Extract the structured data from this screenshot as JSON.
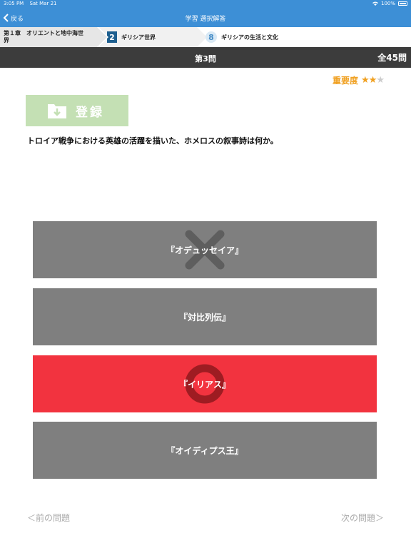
{
  "status_bar": {
    "time": "3:05 PM",
    "date": "Sat Mar 21",
    "battery": "100%"
  },
  "nav": {
    "back_label": "戻る",
    "title": "学習 選択解答"
  },
  "breadcrumb": {
    "chapter": "第１章　オリエントと地中海世界",
    "section_number": "2",
    "section": "ギリシア世界",
    "subsection_number": "8",
    "subsection": "ギリシアの生活と文化"
  },
  "question": {
    "number_label": "第3問",
    "total_label": "全45問",
    "text": "トロイア戦争における英雄の活躍を描いた、ホメロスの叙事詩は何か。"
  },
  "importance": {
    "label": "重要度",
    "stars": 2,
    "max_stars": 3,
    "color": "#f0a020"
  },
  "register": {
    "label": "登録"
  },
  "choices": [
    {
      "label": "『オデュッセイア』",
      "state": "wrong"
    },
    {
      "label": "『対比列伝』",
      "state": "none"
    },
    {
      "label": "『イリアス』",
      "state": "correct"
    },
    {
      "label": "『オイディプス王』",
      "state": "none"
    }
  ],
  "navigation": {
    "prev_label": "＜前の問題",
    "next_label": "次の問題＞"
  },
  "colors": {
    "accent": "#3d8fd6",
    "header": "#3c3c3c",
    "choice": "#7f7f7f",
    "correct": "#f2333f",
    "register": "#c4e0b4"
  }
}
